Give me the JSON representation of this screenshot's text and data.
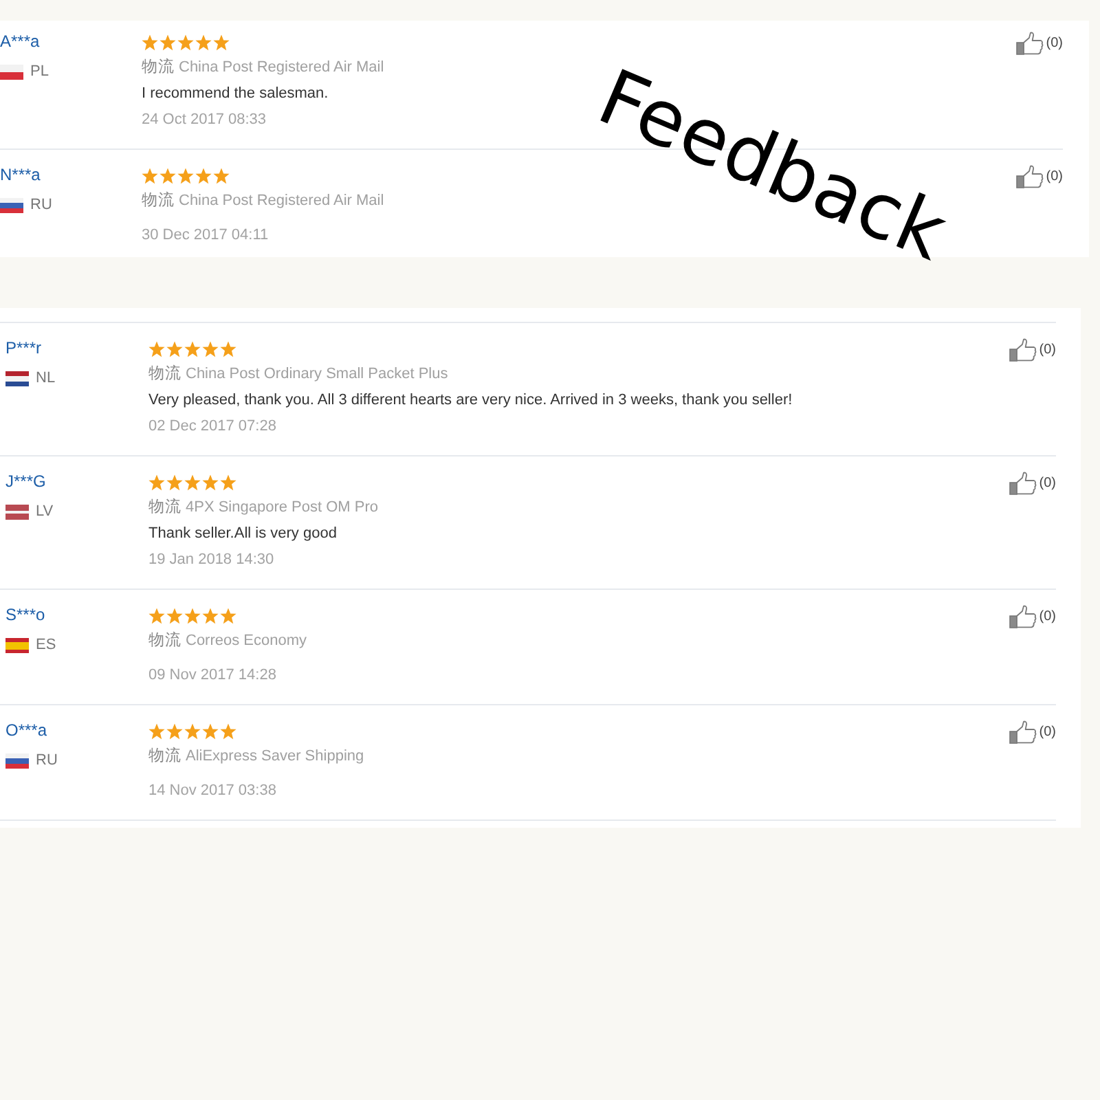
{
  "overlay_title": "Feedback",
  "panels": [
    {
      "reviews": [
        {
          "buyer": "A***a",
          "country": "PL",
          "flag": {
            "kind": "poland"
          },
          "stars": 5,
          "logistics_label": "物流",
          "logistics": "China Post Registered Air Mail",
          "comment": "I recommend the salesman.",
          "date": "24 Oct 2017 08:33",
          "likes": "(0)"
        },
        {
          "buyer": "N***a",
          "country": "RU",
          "flag": {
            "kind": "russia"
          },
          "stars": 5,
          "logistics_label": "物流",
          "logistics": "China Post Registered Air Mail",
          "date": "30 Dec 2017 04:11",
          "likes": "(0)"
        }
      ]
    },
    {
      "reviews": [
        {
          "buyer": "P***r",
          "country": "NL",
          "flag": {
            "kind": "netherlands"
          },
          "stars": 5,
          "logistics_label": "物流",
          "logistics": "China Post Ordinary Small Packet Plus",
          "comment": "Very pleased, thank you. All 3 different hearts are very nice. Arrived in 3 weeks, thank you seller!",
          "date": "02 Dec 2017 07:28",
          "likes": "(0)"
        },
        {
          "buyer": "J***G",
          "country": "LV",
          "flag": {
            "kind": "latvia"
          },
          "stars": 5,
          "logistics_label": "物流",
          "logistics": "4PX Singapore Post OM Pro",
          "comment": "Thank seller.All is very good",
          "date": "19 Jan 2018 14:30",
          "likes": "(0)"
        },
        {
          "buyer": "S***o",
          "country": "ES",
          "flag": {
            "kind": "spain"
          },
          "stars": 5,
          "logistics_label": "物流",
          "logistics": "Correos Economy",
          "date": "09 Nov 2017 14:28",
          "likes": "(0)"
        },
        {
          "buyer": "O***a",
          "country": "RU",
          "flag": {
            "kind": "russia"
          },
          "stars": 5,
          "logistics_label": "物流",
          "logistics": "AliExpress Saver Shipping",
          "date": "14 Nov 2017 03:38",
          "likes": "(0)"
        }
      ]
    }
  ]
}
